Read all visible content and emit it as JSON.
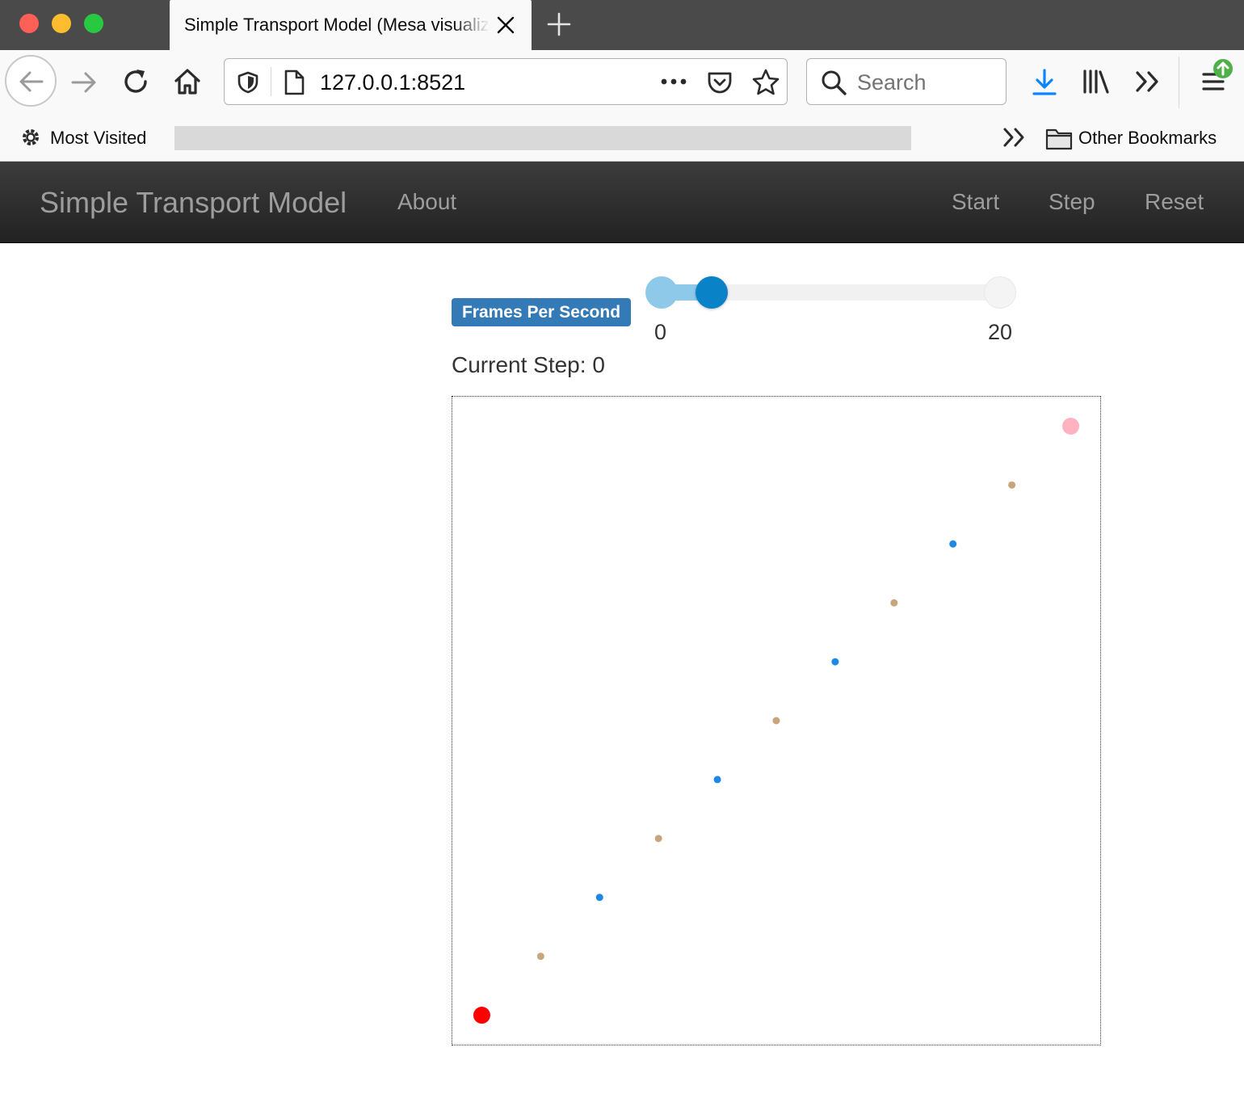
{
  "browser": {
    "tab_title": "Simple Transport Model (Mesa visualization)",
    "url": "127.0.0.1:8521",
    "search_placeholder": "Search",
    "bookmarks": {
      "most_visited": "Most Visited",
      "other_bookmarks": "Other Bookmarks"
    },
    "icons": [
      "back-icon",
      "forward-icon",
      "reload-icon",
      "home-icon",
      "shield-icon",
      "page-icon",
      "more-icon",
      "pocket-icon",
      "star-icon",
      "search-icon",
      "download-icon",
      "library-icon",
      "overflow-icon",
      "menu-icon",
      "update-badge-icon",
      "gear-icon",
      "folder-icon",
      "close-icon",
      "plus-icon"
    ]
  },
  "app": {
    "title": "Simple Transport Model",
    "nav": {
      "about": "About",
      "start": "Start",
      "step": "Step",
      "reset": "Reset"
    },
    "fps": {
      "label": "Frames Per Second",
      "min": "0",
      "max": "20",
      "value": 3
    },
    "current_step_label": "Current Step:",
    "current_step": "0"
  },
  "grid": {
    "width": 11,
    "height": 11,
    "agents": [
      {
        "type": "origin",
        "x": 0,
        "y": 0,
        "color": "#ff0000"
      },
      {
        "type": "node-tan",
        "x": 1,
        "y": 1,
        "color": "#c8a57c"
      },
      {
        "type": "node-blue",
        "x": 2,
        "y": 2,
        "color": "#1e88e5"
      },
      {
        "type": "node-tan",
        "x": 3,
        "y": 3,
        "color": "#c8a57c"
      },
      {
        "type": "node-blue",
        "x": 4,
        "y": 4,
        "color": "#1e88e5"
      },
      {
        "type": "node-tan",
        "x": 5,
        "y": 5,
        "color": "#c8a57c"
      },
      {
        "type": "node-blue",
        "x": 6,
        "y": 6,
        "color": "#1e88e5"
      },
      {
        "type": "node-tan",
        "x": 7,
        "y": 7,
        "color": "#c8a57c"
      },
      {
        "type": "node-blue",
        "x": 8,
        "y": 8,
        "color": "#1e88e5"
      },
      {
        "type": "node-tan",
        "x": 9,
        "y": 9,
        "color": "#c8a57c"
      },
      {
        "type": "destination",
        "x": 10,
        "y": 10,
        "color": "#ffb3c0"
      }
    ]
  }
}
